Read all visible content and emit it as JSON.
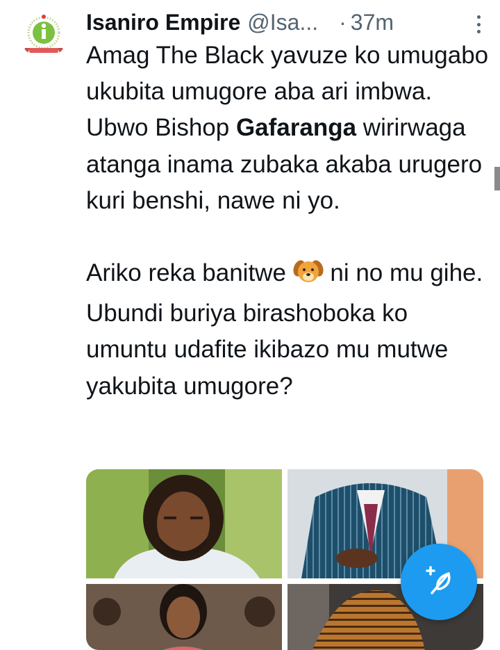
{
  "tweet": {
    "author_name": "Isaniro Empire",
    "author_handle": "@Isa...",
    "separator": "·",
    "timestamp": "37m",
    "avatar_icon": "isaniro-empire-logo-icon",
    "avatar_caption": "ISANIRO EMPIRE",
    "text_before_bold": "Amag The Black yavuze ko umugabo ukubita umugore aba ari imbwa. Ubwo Bishop ",
    "bold_word": "Gafaranga",
    "text_after_bold": " wirirwaga atanga inama zubaka akaba urugero kuri benshi, nawe ni yo.",
    "para2_before_emoji": "Ariko reka banitwe ",
    "emoji_icon": "dog-face-icon",
    "para2_after_emoji": " ni no mu gihe. Ubundi buriya birashoboka ko umuntu udafite ikibazo mu mutwe yakubita umugore?",
    "media": [
      "man-with-dreadlocks-photo",
      "man-in-striped-suit-photo",
      "woman-in-crowd-photo",
      "woman-in-striped-dress-photo"
    ]
  },
  "compose_button_icon": "feather-plus-icon",
  "colors": {
    "accent": "#1d9bf0",
    "text": "#0f1419",
    "secondary_text": "#536471"
  }
}
